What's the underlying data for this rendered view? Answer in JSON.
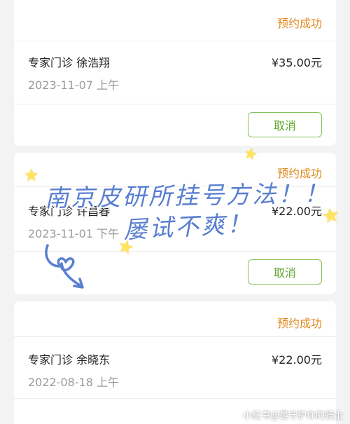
{
  "appointments": [
    {
      "status": "预约成功",
      "title": "专家门诊 徐浩翔",
      "price": "¥35.00元",
      "date": "2023-11-07 上午",
      "cancel_label": "取消"
    },
    {
      "status": "预约成功",
      "title": "专家门诊 许昌春",
      "price": "¥22.00元",
      "date": "2023-11-01 下午",
      "cancel_label": "取消"
    },
    {
      "status": "预约成功",
      "title": "专家门诊 余晓东",
      "price": "¥22.00元",
      "date": "2022-08-18 上午"
    }
  ],
  "overlay": {
    "line1": "南京皮研所挂号方法！！",
    "line2": "屡试不爽！"
  },
  "watermark": "小红书@是守护你的骑士",
  "colors": {
    "status": "#e08a1e",
    "cancel_border": "#86c05a",
    "cancel_text": "#5fa52f",
    "handwriting": "#5a7fd0",
    "star": "#ffe45c"
  }
}
